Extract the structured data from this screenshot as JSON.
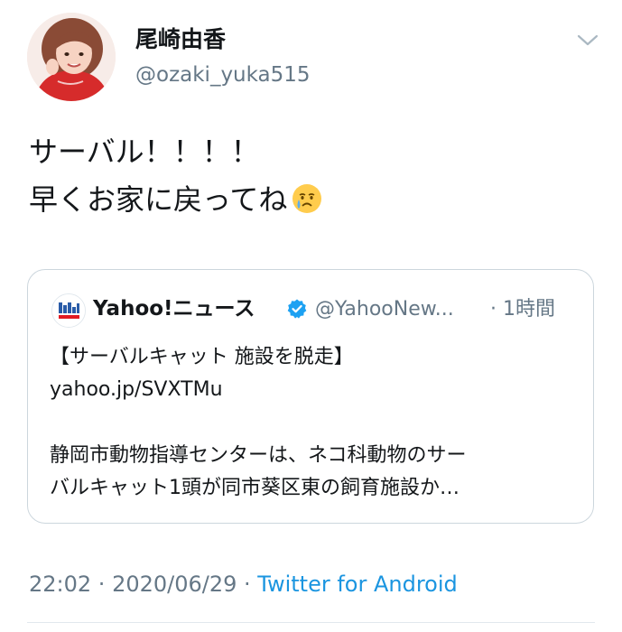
{
  "user": {
    "display_name": "尾崎由香",
    "handle": "@ozaki_yuka515",
    "avatar_icon": "profile-photo"
  },
  "menu": {
    "icon": "chevron-down-icon"
  },
  "tweet": {
    "lines": [
      "サーバル！！！！",
      "早くお家に戻ってね"
    ],
    "emoji": "crying-face-emoji"
  },
  "quoted": {
    "name": "Yahoo!ニュース",
    "verified": true,
    "handle": "@YahooNew...",
    "time": "· 1時間",
    "title": "【サーバルキャット 施設を脱走】",
    "link": "yahoo.jp/SVXTMu",
    "body_lines": [
      "静岡市動物指導センターは、ネコ科動物のサー",
      "バルキャット1頭が同市葵区東の飼育施設か…"
    ]
  },
  "meta": {
    "time": "22:02",
    "date": "2020/06/29",
    "separator": " · ",
    "source": "Twitter for Android"
  },
  "colors": {
    "text": "#14171a",
    "secondary": "#657786",
    "link": "#1b95e0",
    "border": "#ccd6dd",
    "verified": "#1da1f2"
  }
}
